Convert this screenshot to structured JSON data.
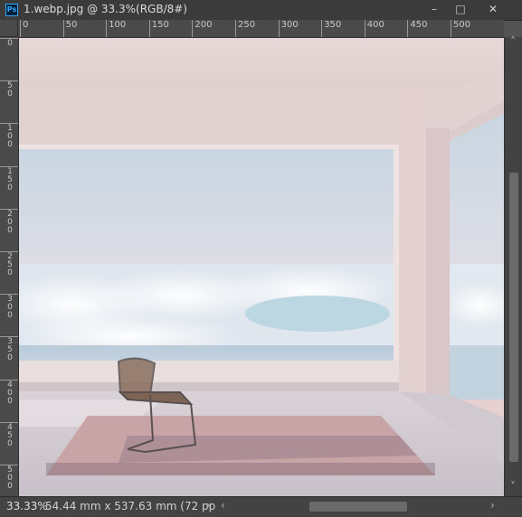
{
  "window": {
    "app_icon": "Ps",
    "title": "1.webp.jpg @ 33.3%(RGB/8#)",
    "minimize_glyph": "–",
    "maximize_glyph": "□",
    "close_glyph": "✕"
  },
  "rulers": {
    "top_labels": [
      "0",
      "50",
      "100",
      "150",
      "200",
      "250",
      "300",
      "350",
      "400",
      "450",
      "500"
    ],
    "left_labels": [
      "0",
      "50",
      "100",
      "150",
      "200",
      "250",
      "300",
      "350",
      "400",
      "450",
      "500"
    ]
  },
  "status": {
    "zoom": "33.33%",
    "document_info": "54.44 mm x 537.63 mm (72 pp",
    "more_arrow": "›",
    "scroll_left": "‹",
    "scroll_right": "›",
    "scroll_up": "˄",
    "scroll_down": "˅"
  },
  "icons": {
    "app": "photoshop-icon",
    "minimize": "minimize-icon",
    "maximize": "maximize-icon",
    "close": "close-icon"
  },
  "colors": {
    "chrome": "#3b3b3b",
    "ruler": "#4a4a4a",
    "accent": "#31a8ff"
  }
}
